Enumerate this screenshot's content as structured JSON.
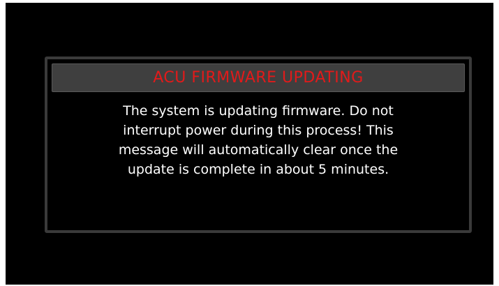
{
  "dialog": {
    "title": "ACU FIRMWARE UPDATING",
    "message_lines": [
      "The system is updating firmware. Do not",
      "interrupt power during this process!  This",
      "message will automatically clear once the",
      "update is complete in about 5 minutes."
    ]
  },
  "colors": {
    "background": "#000000",
    "title_text": "#e21a1a",
    "header_bar": "#3f3f3f",
    "border": "#3a3a3a",
    "body_text": "#ffffff"
  }
}
